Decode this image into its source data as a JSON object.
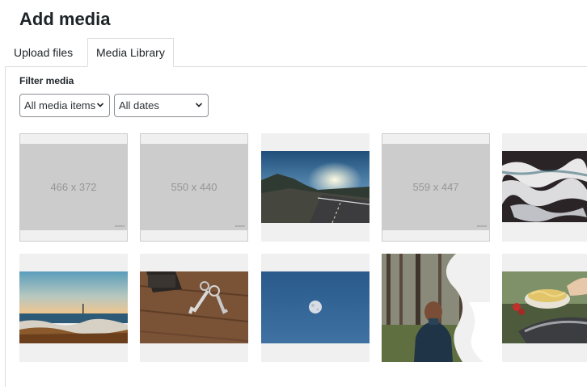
{
  "header": {
    "title": "Add media"
  },
  "tabs": [
    {
      "label": "Upload files",
      "active": false
    },
    {
      "label": "Media Library",
      "active": true
    }
  ],
  "filters": {
    "heading": "Filter media",
    "type_value": "All media items",
    "date_value": "All dates"
  },
  "media": [
    {
      "kind": "placeholder",
      "label": "466 x 372"
    },
    {
      "kind": "placeholder",
      "label": "550 x 440"
    },
    {
      "kind": "photo",
      "subject": "mountain road at sunset"
    },
    {
      "kind": "placeholder",
      "label": "559 x 447"
    },
    {
      "kind": "photo",
      "subject": "ocean waves on dark shore"
    },
    {
      "kind": "photo",
      "subject": "lake shore at dusk"
    },
    {
      "kind": "photo",
      "subject": "keys and wallet on wood"
    },
    {
      "kind": "photo",
      "subject": "moon in blue sky"
    },
    {
      "kind": "photo",
      "subject": "person in forest"
    },
    {
      "kind": "photo",
      "subject": "cooking pasta in pan"
    }
  ],
  "colors": {
    "accent": "#2271b1",
    "border": "#dcdcde",
    "placeholder": "#cccccc"
  }
}
